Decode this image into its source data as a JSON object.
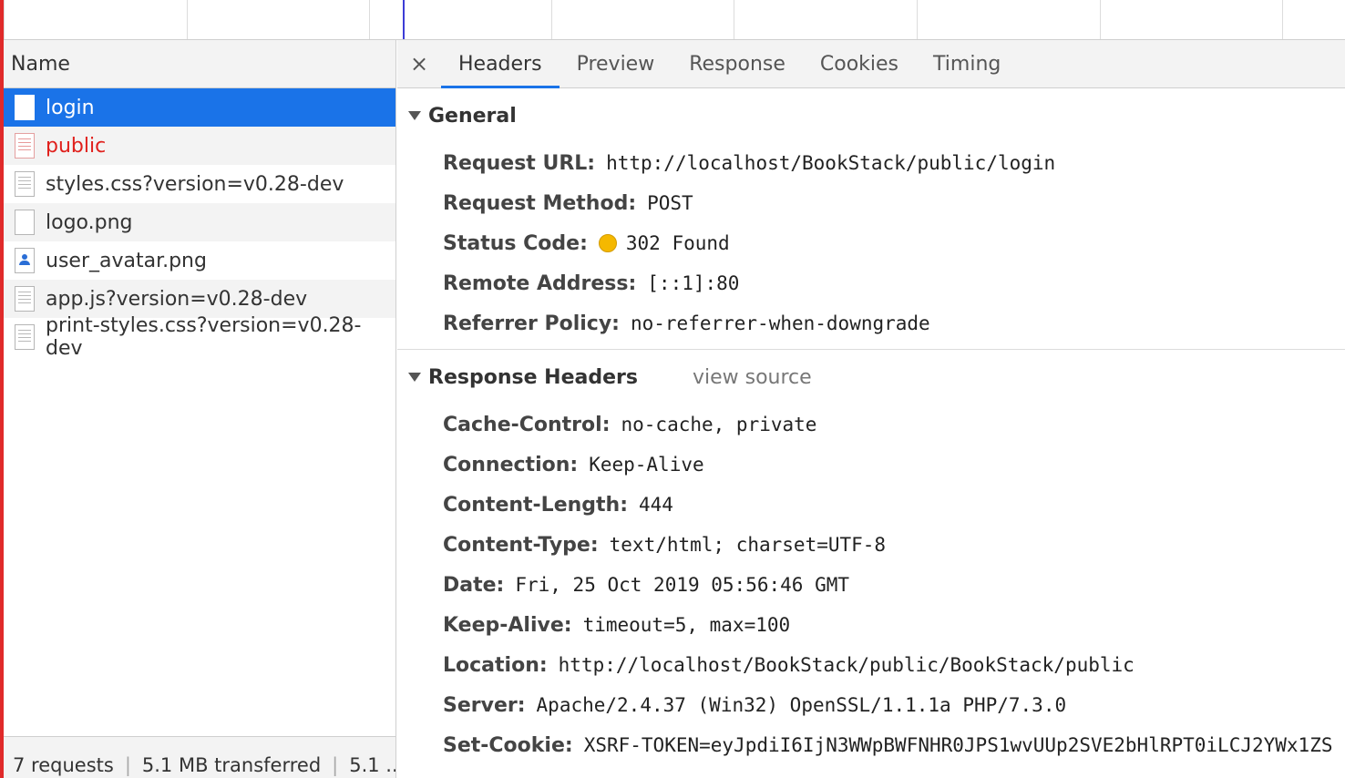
{
  "request_list": {
    "column_header": "Name",
    "items": [
      {
        "label": "login",
        "icon": "document-icon",
        "state": "selected"
      },
      {
        "label": "public",
        "icon": "document-icon",
        "state": "error"
      },
      {
        "label": "styles.css?version=v0.28-dev",
        "icon": "stylesheet-icon",
        "state": "normal"
      },
      {
        "label": "logo.png",
        "icon": "image-file-icon",
        "state": "normal"
      },
      {
        "label": "user_avatar.png",
        "icon": "avatar-image-icon",
        "state": "normal"
      },
      {
        "label": "app.js?version=v0.28-dev",
        "icon": "script-icon",
        "state": "normal"
      },
      {
        "label": "print-styles.css?version=v0.28-dev",
        "icon": "stylesheet-icon",
        "state": "normal"
      }
    ]
  },
  "status_bar": {
    "requests": "7 requests",
    "separator": "|",
    "transferred": "5.1 MB transferred",
    "resources": "5.1 ..."
  },
  "detail_tabs": {
    "close_symbol": "×",
    "tabs": [
      "Headers",
      "Preview",
      "Response",
      "Cookies",
      "Timing"
    ],
    "active": "Headers"
  },
  "general": {
    "title": "General",
    "fields": [
      {
        "key": "Request URL:",
        "value": "http://localhost/BookStack/public/login"
      },
      {
        "key": "Request Method:",
        "value": "POST"
      },
      {
        "key": "Status Code:",
        "value": "302 Found",
        "status_color": "#f5b800"
      },
      {
        "key": "Remote Address:",
        "value": "[::1]:80"
      },
      {
        "key": "Referrer Policy:",
        "value": "no-referrer-when-downgrade"
      }
    ]
  },
  "response_headers": {
    "title": "Response Headers",
    "view_source": "view source",
    "fields": [
      {
        "key": "Cache-Control:",
        "value": "no-cache, private"
      },
      {
        "key": "Connection:",
        "value": "Keep-Alive"
      },
      {
        "key": "Content-Length:",
        "value": "444"
      },
      {
        "key": "Content-Type:",
        "value": "text/html; charset=UTF-8"
      },
      {
        "key": "Date:",
        "value": "Fri, 25 Oct 2019 05:56:46 GMT"
      },
      {
        "key": "Keep-Alive:",
        "value": "timeout=5, max=100"
      },
      {
        "key": "Location:",
        "value": "http://localhost/BookStack/public/BookStack/public"
      },
      {
        "key": "Server:",
        "value": "Apache/2.4.37 (Win32) OpenSSL/1.1.1a PHP/7.3.0"
      },
      {
        "key": "Set-Cookie:",
        "value": "XSRF-TOKEN=eyJpdiI6IjN3WWpBWFNHR0JPS1wvUUp2SVE2bHlRPT0iLCJ2YWx1ZS"
      }
    ]
  },
  "colors": {
    "selection": "#1a73e8",
    "error_text": "#e0201c",
    "timeline_marker": "#3d3dd6"
  }
}
